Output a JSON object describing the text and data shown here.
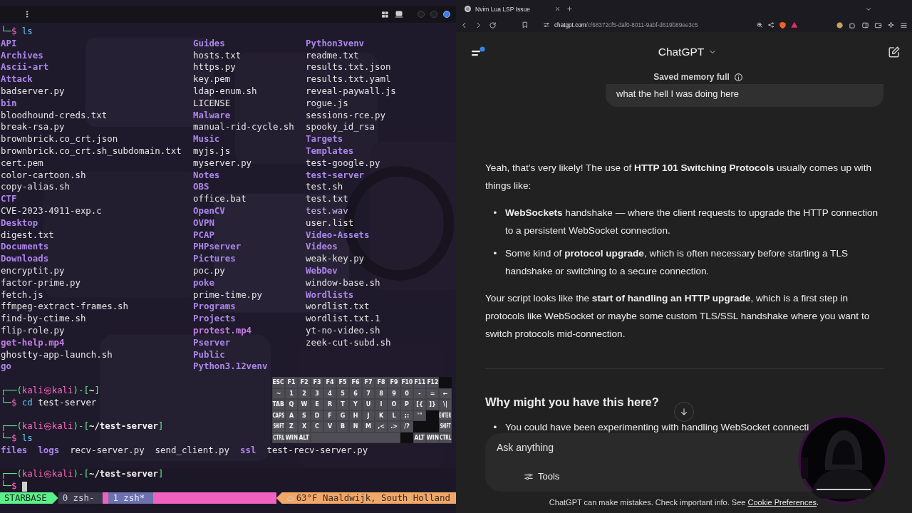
{
  "terminal": {
    "first_input": {
      "corner": "└─",
      "symbol": "$",
      "command": "ls"
    },
    "listing": [
      [
        {
          "name": "API",
          "kind": "dir"
        },
        {
          "name": "Archives",
          "kind": "dir"
        },
        {
          "name": "Ascii-art",
          "kind": "dir"
        },
        {
          "name": "Attack",
          "kind": "dir"
        },
        {
          "name": "badserver.py",
          "kind": "file"
        },
        {
          "name": "bin",
          "kind": "dir"
        },
        {
          "name": "bloodhound-creds.txt",
          "kind": "file"
        },
        {
          "name": "break-rsa.py",
          "kind": "file"
        },
        {
          "name": "brownbrick.co_crt.json",
          "kind": "file"
        },
        {
          "name": "brownbrick.co_crt.sh_subdomain.txt",
          "kind": "file"
        },
        {
          "name": "cert.pem",
          "kind": "file"
        },
        {
          "name": "color-cartoon.sh",
          "kind": "file"
        },
        {
          "name": "copy-alias.sh",
          "kind": "file"
        },
        {
          "name": "CTF",
          "kind": "dir"
        },
        {
          "name": "CVE-2023-4911-exp.c",
          "kind": "file"
        },
        {
          "name": "Desktop",
          "kind": "dir"
        },
        {
          "name": "digest.txt",
          "kind": "file"
        },
        {
          "name": "Documents",
          "kind": "dir"
        },
        {
          "name": "Downloads",
          "kind": "dir"
        },
        {
          "name": "encryptit.py",
          "kind": "file"
        },
        {
          "name": "factor-prime.py",
          "kind": "file"
        },
        {
          "name": "fetch.js",
          "kind": "file"
        },
        {
          "name": "ffmpeg-extract-frames.sh",
          "kind": "file"
        },
        {
          "name": "find-by-ctime.sh",
          "kind": "file"
        },
        {
          "name": "flip-role.py",
          "kind": "file"
        },
        {
          "name": "get-help.mp4",
          "kind": "media"
        },
        {
          "name": "ghostty-app-launch.sh",
          "kind": "file"
        },
        {
          "name": "go",
          "kind": "dir"
        }
      ],
      [
        {
          "name": "Guides",
          "kind": "dir"
        },
        {
          "name": "hosts.txt",
          "kind": "file"
        },
        {
          "name": "https.py",
          "kind": "file"
        },
        {
          "name": "key.pem",
          "kind": "file"
        },
        {
          "name": "ldap-enum.sh",
          "kind": "file"
        },
        {
          "name": "LICENSE",
          "kind": "file"
        },
        {
          "name": "Malware",
          "kind": "dir"
        },
        {
          "name": "manual-rid-cycle.sh",
          "kind": "file"
        },
        {
          "name": "Music",
          "kind": "dir"
        },
        {
          "name": "myjs.js",
          "kind": "file"
        },
        {
          "name": "myserver.py",
          "kind": "file"
        },
        {
          "name": "Notes",
          "kind": "dir"
        },
        {
          "name": "OBS",
          "kind": "dir"
        },
        {
          "name": "office.bat",
          "kind": "file"
        },
        {
          "name": "OpenCV",
          "kind": "dir"
        },
        {
          "name": "OVPN",
          "kind": "dir"
        },
        {
          "name": "PCAP",
          "kind": "dir"
        },
        {
          "name": "PHPserver",
          "kind": "dir"
        },
        {
          "name": "Pictures",
          "kind": "dir"
        },
        {
          "name": "poc.py",
          "kind": "file"
        },
        {
          "name": "poke",
          "kind": "dir"
        },
        {
          "name": "prime-time.py",
          "kind": "file"
        },
        {
          "name": "Programs",
          "kind": "dir"
        },
        {
          "name": "Projects",
          "kind": "dir"
        },
        {
          "name": "protest.mp4",
          "kind": "media"
        },
        {
          "name": "Pserver",
          "kind": "dir"
        },
        {
          "name": "Public",
          "kind": "dir"
        },
        {
          "name": "Python3.12venv",
          "kind": "dir"
        }
      ],
      [
        {
          "name": "Python3venv",
          "kind": "dir"
        },
        {
          "name": "readme.txt",
          "kind": "file"
        },
        {
          "name": "results.txt.json",
          "kind": "file"
        },
        {
          "name": "results.txt.yaml",
          "kind": "file"
        },
        {
          "name": "reveal-paywall.js",
          "kind": "file"
        },
        {
          "name": "rogue.js",
          "kind": "file"
        },
        {
          "name": "sessions-rce.py",
          "kind": "file"
        },
        {
          "name": "spooky_id_rsa",
          "kind": "file"
        },
        {
          "name": "Targets",
          "kind": "dir"
        },
        {
          "name": "Templates",
          "kind": "dir"
        },
        {
          "name": "test-google.py",
          "kind": "file"
        },
        {
          "name": "test-server",
          "kind": "dir"
        },
        {
          "name": "test.sh",
          "kind": "file"
        },
        {
          "name": "test.txt",
          "kind": "file"
        },
        {
          "name": "test.wav",
          "kind": "audio"
        },
        {
          "name": "user.list",
          "kind": "file"
        },
        {
          "name": "Video-Assets",
          "kind": "dir"
        },
        {
          "name": "Videos",
          "kind": "dir"
        },
        {
          "name": "weak-key.py",
          "kind": "file"
        },
        {
          "name": "WebDev",
          "kind": "dir"
        },
        {
          "name": "window-base.sh",
          "kind": "file"
        },
        {
          "name": "Wordlists",
          "kind": "dir"
        },
        {
          "name": "wordlist.txt",
          "kind": "file"
        },
        {
          "name": "wordlist.txt.1",
          "kind": "file"
        },
        {
          "name": "yt-no-video.sh",
          "kind": "file"
        },
        {
          "name": "zeek-cut-subd.sh",
          "kind": "file"
        }
      ]
    ],
    "sessions": [
      {
        "prompt": {
          "open": "┌──(",
          "user_host": "kali㉿kali",
          "mid": ")-[",
          "path": "~",
          "close": "]"
        },
        "input": {
          "corner": "└─",
          "symbol": "$",
          "command": "cd",
          "argument": "test-server"
        }
      },
      {
        "prompt": {
          "open": "┌──(",
          "user_host": "kali㉿kali",
          "mid": ")-[",
          "path": "~/test-server",
          "close": "]"
        },
        "input": {
          "corner": "└─",
          "symbol": "$",
          "command": "ls"
        },
        "output": [
          {
            "name": "files",
            "kind": "dir"
          },
          {
            "name": "logs",
            "kind": "dir"
          },
          {
            "name": "recv-server.py",
            "kind": "file"
          },
          {
            "name": "send_client.py",
            "kind": "file"
          },
          {
            "name": "ssl",
            "kind": "dir"
          },
          {
            "name": "test-recv-server.py",
            "kind": "file"
          }
        ]
      },
      {
        "prompt": {
          "open": "┌──(",
          "user_host": "kali㉿kali",
          "mid": ")-[",
          "path": "~/test-server",
          "close": "]"
        },
        "input": {
          "corner": "└─",
          "symbol": "$",
          "cursor": true
        }
      }
    ],
    "status_bar": {
      "session": "STARBASE",
      "windows": [
        {
          "label": "0 zsh-",
          "selected": false
        },
        {
          "label": "1 zsh*",
          "selected": true
        }
      ],
      "weather": "63°F Naaldwijk, South Holland"
    }
  },
  "browser": {
    "tab": {
      "title": "Nvim Lua LSP Issue"
    },
    "url": {
      "host": "chatgpt.com",
      "path": "/c/68372cf5-daf0-8011-9abf-d619b89ee3c5"
    }
  },
  "chat": {
    "title": "ChatGPT",
    "memory_banner": "Saved memory full",
    "user_message": "what the hell I was doing here",
    "answer": [
      {
        "kind": "paragraph",
        "text": "Yeah, that’s very likely! The use of **HTTP 101 Switching Protocols** usually comes up with things like:"
      },
      {
        "kind": "bullets",
        "marker": "•",
        "items": [
          "**WebSockets** handshake — where the client requests to upgrade the HTTP connection to a persistent WebSocket connection.",
          "Some kind of **protocol upgrade**, which is often necessary before starting a TLS handshake or switching to a secure connection."
        ]
      },
      {
        "kind": "paragraph",
        "text": "Your script looks like the **start of handling an HTTP upgrade**, which is a first step in protocols like WebSocket or maybe some custom TLS/SSL handshake where you want to switch protocols mid-connection."
      },
      {
        "kind": "rule"
      },
      {
        "kind": "heading",
        "text": "Why might you have this here?"
      },
      {
        "kind": "bullets",
        "marker": "•",
        "items": [
          "You could have been experimenting with handling WebSocket connecti"
        ]
      }
    ],
    "composer": {
      "placeholder": "Ask anything",
      "tools": "Tools"
    },
    "footer": {
      "text": "ChatGPT can make mistakes. Check important info. See ",
      "link": "Cookie Preferences",
      "end": "."
    }
  },
  "keyboard": {
    "rows": [
      [
        {
          "kind": "key",
          "label": "ESC"
        },
        {
          "kind": "key",
          "label": "F1"
        },
        {
          "kind": "key",
          "label": "F2"
        },
        {
          "kind": "key",
          "label": "F3"
        },
        {
          "kind": "key",
          "label": "F4"
        },
        {
          "kind": "key",
          "label": "F5"
        },
        {
          "kind": "key",
          "label": "F6"
        },
        {
          "kind": "key",
          "label": "F7"
        },
        {
          "kind": "key",
          "label": "F8"
        },
        {
          "kind": "key",
          "label": "F9"
        },
        {
          "kind": "key",
          "label": "F10"
        },
        {
          "kind": "key",
          "label": "F11"
        },
        {
          "kind": "key",
          "label": "F12"
        },
        {
          "kind": "gap"
        }
      ],
      [
        {
          "kind": "key",
          "label": "~"
        },
        {
          "kind": "key",
          "label": "1"
        },
        {
          "kind": "key",
          "label": "2"
        },
        {
          "kind": "key",
          "label": "3"
        },
        {
          "kind": "key",
          "label": "4"
        },
        {
          "kind": "key",
          "label": "5"
        },
        {
          "kind": "key",
          "label": "6"
        },
        {
          "kind": "key",
          "label": "7"
        },
        {
          "kind": "key",
          "label": "8"
        },
        {
          "kind": "key",
          "label": "9"
        },
        {
          "kind": "key",
          "label": "0"
        },
        {
          "kind": "key",
          "label": "-"
        },
        {
          "kind": "key",
          "label": "="
        },
        {
          "kind": "key",
          "label": "←"
        }
      ],
      [
        {
          "kind": "key",
          "label": "TAB"
        },
        {
          "kind": "key",
          "label": "Q"
        },
        {
          "kind": "key",
          "label": "W"
        },
        {
          "kind": "key",
          "label": "E"
        },
        {
          "kind": "key",
          "label": "R"
        },
        {
          "kind": "key",
          "label": "T"
        },
        {
          "kind": "key",
          "label": "Y"
        },
        {
          "kind": "key",
          "label": "U"
        },
        {
          "kind": "key",
          "label": "I"
        },
        {
          "kind": "key",
          "label": "O"
        },
        {
          "kind": "key",
          "label": "P"
        },
        {
          "kind": "key",
          "label": "[{"
        },
        {
          "kind": "key",
          "label": "]}"
        },
        {
          "kind": "key",
          "label": "\\|"
        }
      ],
      [
        {
          "kind": "key",
          "label": "CAPS"
        },
        {
          "kind": "key",
          "label": "A"
        },
        {
          "kind": "key",
          "label": "S"
        },
        {
          "kind": "key",
          "label": "D"
        },
        {
          "kind": "key",
          "label": "F"
        },
        {
          "kind": "key",
          "label": "G"
        },
        {
          "kind": "key",
          "label": "H"
        },
        {
          "kind": "key",
          "label": "J"
        },
        {
          "kind": "key",
          "label": "K"
        },
        {
          "kind": "key",
          "label": "L"
        },
        {
          "kind": "key",
          "label": ";:"
        },
        {
          "kind": "key",
          "label": "'\""
        },
        {
          "kind": "gap"
        },
        {
          "kind": "key",
          "label": "ENTER"
        }
      ],
      [
        {
          "kind": "key",
          "label": "SHIFT"
        },
        {
          "kind": "key",
          "label": "Z"
        },
        {
          "kind": "key",
          "label": "X"
        },
        {
          "kind": "key",
          "label": "C"
        },
        {
          "kind": "key",
          "label": "V"
        },
        {
          "kind": "key",
          "label": "B"
        },
        {
          "kind": "key",
          "label": "N"
        },
        {
          "kind": "key",
          "label": "M"
        },
        {
          "kind": "key",
          "label": ",<"
        },
        {
          "kind": "key",
          "label": ".>"
        },
        {
          "kind": "key",
          "label": "/?"
        },
        {
          "kind": "gap"
        },
        {
          "kind": "gap"
        },
        {
          "kind": "key",
          "label": "SHIFT"
        }
      ],
      [
        {
          "kind": "key",
          "label": "CTRL"
        },
        {
          "kind": "key",
          "label": "WIN"
        },
        {
          "kind": "key",
          "label": "ALT"
        },
        {
          "kind": "space"
        },
        "",
        "",
        "",
        "",
        "",
        "",
        {
          "kind": "gap"
        },
        {
          "kind": "key",
          "label": "ALT"
        },
        {
          "kind": "key",
          "label": "WIN"
        },
        {
          "kind": "key",
          "label": "CTRL"
        }
      ]
    ]
  }
}
